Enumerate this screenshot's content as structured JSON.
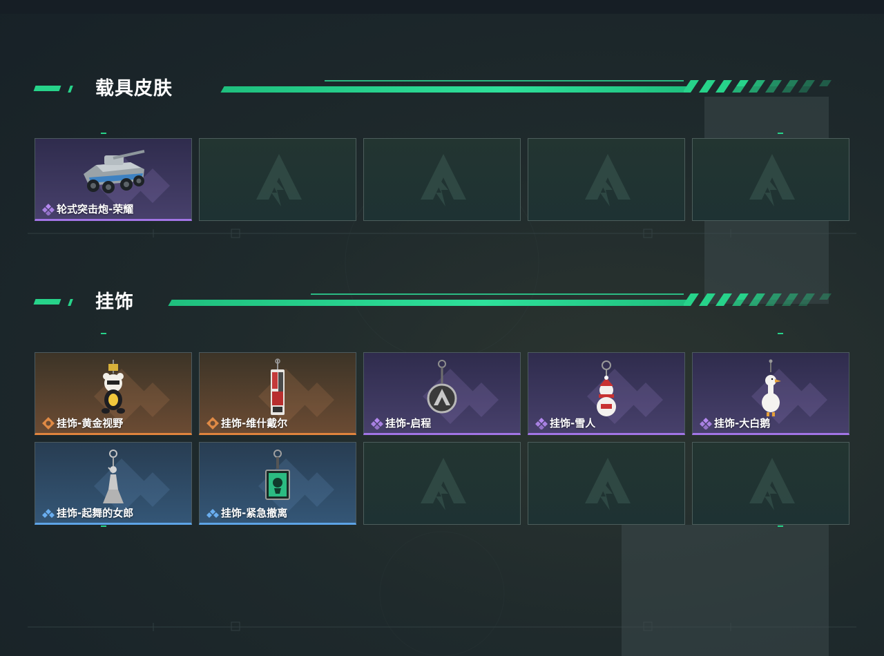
{
  "sections": [
    {
      "title": "载具皮肤",
      "items": [
        {
          "label": "轮式突击炮-荣耀",
          "rarity": "purple",
          "icon": "armored-vehicle-icon"
        },
        {
          "empty": true
        },
        {
          "empty": true
        },
        {
          "empty": true
        },
        {
          "empty": true
        }
      ]
    },
    {
      "title": "挂饰",
      "items": [
        {
          "label": "挂饰-黄金视野",
          "rarity": "orange",
          "icon": "bear-charm-icon"
        },
        {
          "label": "挂饰-维什戴尔",
          "rarity": "orange",
          "icon": "card-charm-icon"
        },
        {
          "label": "挂饰-启程",
          "rarity": "purple",
          "icon": "medallion-charm-icon"
        },
        {
          "label": "挂饰-雪人",
          "rarity": "purple",
          "icon": "snowman-charm-icon"
        },
        {
          "label": "挂饰-大白鹅",
          "rarity": "purple",
          "icon": "goose-charm-icon"
        },
        {
          "label": "挂饰-起舞的女郎",
          "rarity": "blue",
          "icon": "dancer-charm-icon"
        },
        {
          "label": "挂饰-紧急撤离",
          "rarity": "blue",
          "icon": "evac-tag-charm-icon"
        },
        {
          "empty": true
        },
        {
          "empty": true
        },
        {
          "empty": true
        }
      ]
    }
  ],
  "colors": {
    "accent": "#27d38a",
    "purple": "#a275e6",
    "orange": "#e0843d",
    "blue": "#5da3e6"
  }
}
